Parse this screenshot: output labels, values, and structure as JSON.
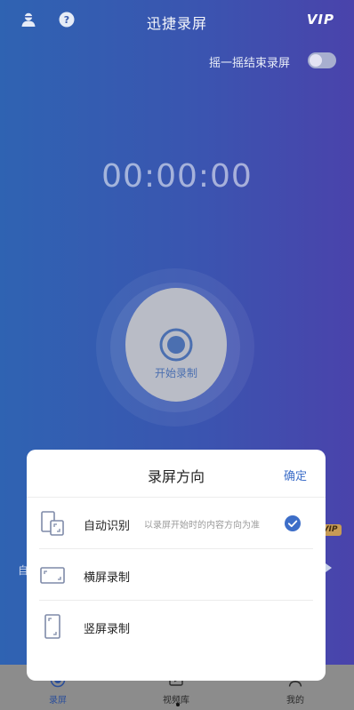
{
  "header": {
    "title": "迅捷录屏",
    "vip": "VIP",
    "left_icons": [
      "user-icon",
      "help-icon"
    ]
  },
  "shake": {
    "label": "摇一摇结束录屏",
    "enabled": false
  },
  "timer": {
    "value": "00:00:00"
  },
  "record": {
    "label": "开始录制"
  },
  "background": {
    "vip_badge": "VIP",
    "left_text": "自"
  },
  "bottom_nav": {
    "items": [
      {
        "label": "录屏",
        "icon": "record-icon",
        "active": true
      },
      {
        "label": "视频库",
        "icon": "video-library-icon",
        "active": false
      },
      {
        "label": "我的",
        "icon": "person-icon",
        "active": false
      }
    ]
  },
  "sheet": {
    "title": "录屏方向",
    "confirm": "确定",
    "options": [
      {
        "label": "自动识别",
        "description": "以录屏开始时的内容方向为准",
        "selected": true,
        "icon": "auto-rotate-icon"
      },
      {
        "label": "横屏录制",
        "description": "",
        "selected": false,
        "icon": "landscape-icon"
      },
      {
        "label": "竖屏录制",
        "description": "",
        "selected": false,
        "icon": "portrait-icon"
      }
    ]
  },
  "colors": {
    "accent": "#3d6ec8",
    "gradient_start": "#2f63b2",
    "gradient_end": "#4a43ab"
  }
}
